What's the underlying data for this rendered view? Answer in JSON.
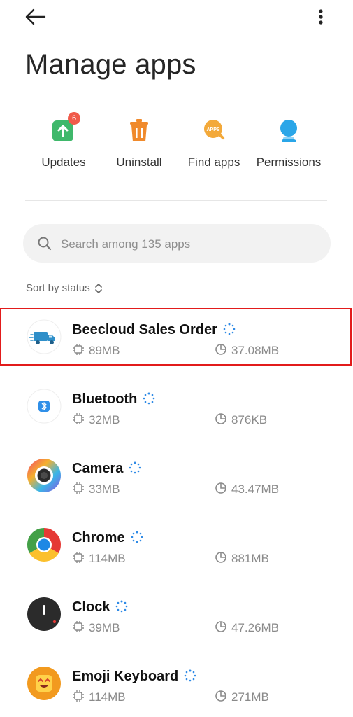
{
  "header": {
    "title": "Manage apps",
    "back_icon": "arrow-left-icon",
    "menu_icon": "more-vertical-icon"
  },
  "actions": [
    {
      "label": "Updates",
      "icon": "update-arrow-icon",
      "badge": "6",
      "color": "#3fb86b"
    },
    {
      "label": "Uninstall",
      "icon": "trash-icon",
      "color": "#f08a2c"
    },
    {
      "label": "Find apps",
      "icon": "find-apps-icon",
      "color": "#f3a93a"
    },
    {
      "label": "Permissions",
      "icon": "person-shield-icon",
      "color": "#2aa6e8"
    }
  ],
  "search": {
    "placeholder": "Search among 135 apps",
    "icon": "search-icon"
  },
  "sort": {
    "label": "Sort by status",
    "icon": "sort-toggle-icon"
  },
  "apps": [
    {
      "name": "Beecloud Sales Order",
      "size": "89MB",
      "data": "37.08MB",
      "icon": "beecloud-app-icon",
      "selected": true
    },
    {
      "name": "Bluetooth",
      "size": "32MB",
      "data": "876KB",
      "icon": "bluetooth-app-icon"
    },
    {
      "name": "Camera",
      "size": "33MB",
      "data": "43.47MB",
      "icon": "camera-app-icon"
    },
    {
      "name": "Chrome",
      "size": "114MB",
      "data": "881MB",
      "icon": "chrome-app-icon"
    },
    {
      "name": "Clock",
      "size": "39MB",
      "data": "47.26MB",
      "icon": "clock-app-icon"
    },
    {
      "name": "Emoji Keyboard",
      "size": "114MB",
      "data": "271MB",
      "icon": "emoji-keyboard-app-icon"
    }
  ],
  "colors": {
    "selection_outline": "#e21b1b",
    "badge": "#f05a4a",
    "loading": "#2e8ae6"
  }
}
